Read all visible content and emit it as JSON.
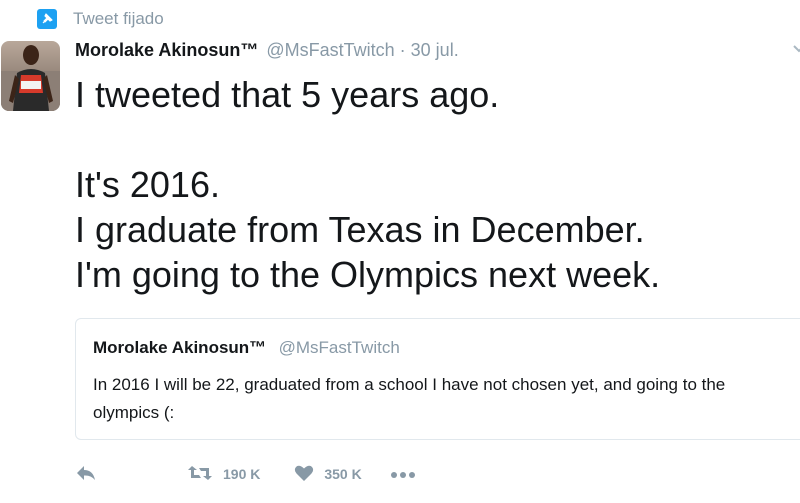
{
  "pinned": {
    "label": "Tweet fijado",
    "icon": "pin-icon"
  },
  "author": {
    "name": "Morolake Akinosun™",
    "handle": "@MsFastTwitch",
    "separator": "·",
    "date": "30 jul."
  },
  "tweet": {
    "lines": [
      "I tweeted that 5 years ago.",
      "It's 2016.",
      "I graduate from Texas in December.",
      "I'm going to the Olympics next week."
    ]
  },
  "quoted": {
    "name": "Morolake Akinosun™",
    "handle": "@MsFastTwitch",
    "text": "In 2016 I will be 22, graduated from a school I have not chosen yet, and going to the olympics (:"
  },
  "actions": {
    "reply": {
      "icon": "reply-icon"
    },
    "retweet": {
      "icon": "retweet-icon",
      "count": "190 K"
    },
    "like": {
      "icon": "heart-icon",
      "count": "350 K"
    },
    "more": {
      "icon": "more-icon"
    }
  },
  "colors": {
    "accent": "#1da1f2",
    "muted": "#8899a6",
    "text": "#14171a",
    "border": "#e1e8ed"
  }
}
